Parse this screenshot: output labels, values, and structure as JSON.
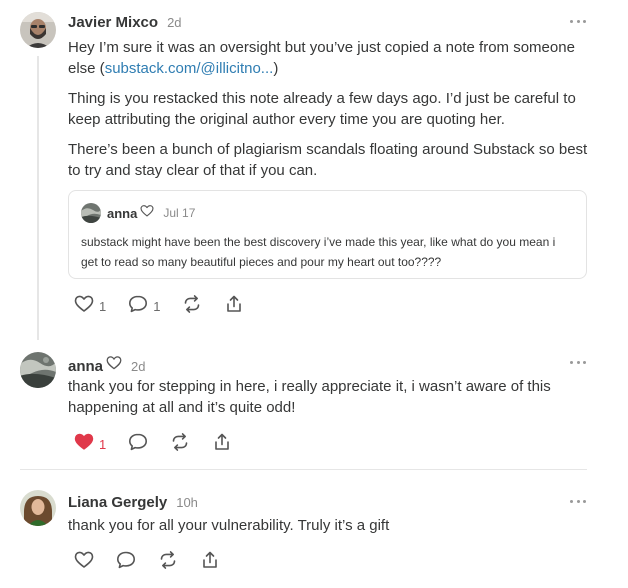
{
  "comments": [
    {
      "author": "Javier Mixco",
      "time": "2d",
      "text_1_prefix": "Hey I’m sure it was an oversight but you’ve just copied a note from someone else (",
      "text_1_link": "substack.com/@illicitno...",
      "text_1_suffix": ")",
      "text_2": "Thing is you restacked this note already a few days ago. I’d just be careful to keep attributing the original author every time you are quoting her.",
      "text_3": "There’s been a bunch of plagiarism scandals floating around Substack so best to try and stay clear of that if you can.",
      "quote": {
        "author": "anna",
        "time": "Jul 17",
        "text": "substack might have been the best discovery i’ve made this year, like what do you mean i get to read so many beautiful pieces and pour my heart out too????"
      },
      "likes": "1",
      "replies": "1"
    },
    {
      "author": "anna",
      "time": "2d",
      "text": "thank you for stepping in here, i really appreciate it, i wasn’t aware of this happening at all and it’s quite odd!",
      "likes": "1",
      "liked": true
    },
    {
      "author": "Liana Gergely",
      "time": "10h",
      "text": "thank you for all your vulnerability. Truly it’s a gift"
    }
  ],
  "icons": {
    "like": "heart-icon",
    "reply": "comment-icon",
    "restack": "restack-icon",
    "share": "share-icon",
    "more": "more-icon"
  },
  "colors": {
    "text": "#363737",
    "muted": "#8a8a8a",
    "link": "#2f7db2",
    "liked": "#e0384a"
  }
}
